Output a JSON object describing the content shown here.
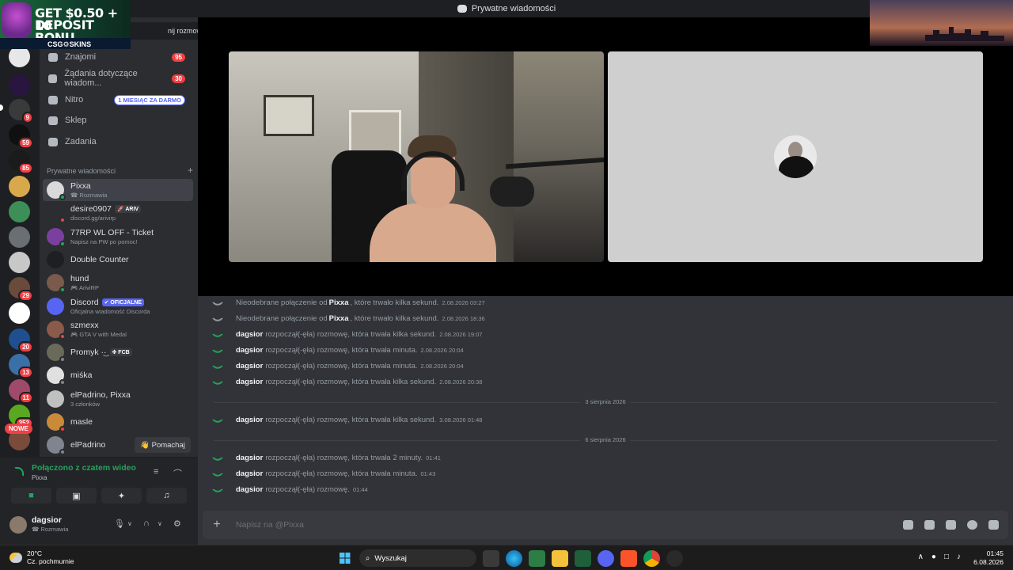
{
  "window": {
    "title": "Prywatne wiadomości"
  },
  "ad": {
    "line1": "GET $0.50 + 10",
    "line2": "DEPOSIT BONU",
    "brand": "CSG⚙SKINS"
  },
  "search": {
    "fragment": "nij rozmowę"
  },
  "rail": {
    "badges": [
      "9",
      "59",
      "85",
      "29",
      "20",
      "13",
      "11",
      "352"
    ],
    "new_label": "NOWE"
  },
  "nav": {
    "friends": {
      "label": "Znajomi",
      "count": "95"
    },
    "requests": {
      "label": "Żądania dotyczące wiadom...",
      "count": "30"
    },
    "nitro": {
      "label": "Nitro",
      "tag": "1 MIESIĄC ZA DARMO"
    },
    "shop": {
      "label": "Sklep"
    },
    "quests": {
      "label": "Zadania"
    }
  },
  "dm_header": {
    "label": "Prywatne wiadomości",
    "add": "+"
  },
  "dms": [
    {
      "name": "Pixxa",
      "sub": "☎ Rozmawia",
      "status": "online",
      "avatar_color": "#d9d9d9"
    },
    {
      "name": "desire0907",
      "tag": "🚀 ARIV",
      "sub": "discord.gg/arivirp",
      "status": "dnd",
      "avatar_color": "#2b2d31"
    },
    {
      "name": "77RP WL OFF - Ticket",
      "sub": "Napisz na PW po pomoc!",
      "status": "online",
      "avatar_color": "#7b3fa0"
    },
    {
      "name": "Double Counter",
      "sub": "",
      "status": "none",
      "avatar_color": "#1e1f22"
    },
    {
      "name": "hund",
      "sub": "🎮 AriviRP",
      "status": "online",
      "avatar_color": "#7a5a4a"
    },
    {
      "name": "Discord",
      "tag": "✔ OFICJALNE",
      "sub": "Oficjalna wiadomość Discorda",
      "status": "none",
      "avatar_color": "#5865f2"
    },
    {
      "name": "szmexx",
      "sub": "🎮 GTA V with Medal",
      "status": "dnd",
      "avatar_color": "#8a5a4a"
    },
    {
      "name": "Promyk ·͜·",
      "tag": "✤ FCB",
      "sub": "",
      "status": "off",
      "avatar_color": "#6a6a5a"
    },
    {
      "name": "miśka",
      "sub": "",
      "status": "off",
      "avatar_color": "#e0e0e0"
    },
    {
      "name": "elPadrino, Pixxa",
      "sub": "3 członków",
      "status": "none",
      "avatar_color": "#c0c0c0"
    },
    {
      "name": "masle",
      "sub": "",
      "status": "dnd",
      "avatar_color": "#c98a3a"
    },
    {
      "name": "elPadrino",
      "sub": "",
      "status": "off",
      "avatar_color": "#80848e"
    }
  ],
  "wave_button": "👋 Pomachaj",
  "voice": {
    "title": "Połączono z czatem wideo",
    "sub": "Pixxa"
  },
  "user": {
    "name": "dagsior",
    "status": "☎ Rozmawia"
  },
  "messages": [
    {
      "type": "missed",
      "prefix": "Nieodebrane połączenie od",
      "who": "Pixxa",
      "text": ", które trwało kilka sekund.",
      "ts": "2.08.2026 03:27"
    },
    {
      "type": "missed",
      "prefix": "Nieodebrane połączenie od",
      "who": "Pixxa",
      "text": ", które trwało kilka sekund.",
      "ts": "2.08.2026 18:36"
    },
    {
      "type": "call",
      "who": "dagsior",
      "text": "rozpoczął(-ęła) rozmowę, która trwała kilka sekund.",
      "ts": "2.08.2026 19:07"
    },
    {
      "type": "call",
      "who": "dagsior",
      "text": "rozpoczął(-ęła) rozmowę, która trwała minuta.",
      "ts": "2.08.2026 20:04"
    },
    {
      "type": "call",
      "who": "dagsior",
      "text": "rozpoczął(-ęła) rozmowę, która trwała minuta.",
      "ts": "2.08.2026 20:04"
    },
    {
      "type": "call",
      "who": "dagsior",
      "text": "rozpoczął(-ęła) rozmowę, która trwała kilka sekund.",
      "ts": "2.08.2026 20:38"
    },
    {
      "type": "divider",
      "label": "3 sierpnia 2026"
    },
    {
      "type": "call",
      "who": "dagsior",
      "text": "rozpoczął(-ęła) rozmowę, która trwała kilka sekund.",
      "ts": "3.08.2026 01:48"
    },
    {
      "type": "divider",
      "label": "6 sierpnia 2026"
    },
    {
      "type": "call",
      "who": "dagsior",
      "text": "rozpoczął(-ęła) rozmowę, która trwała 2 minuty.",
      "ts": "01:41"
    },
    {
      "type": "call",
      "who": "dagsior",
      "text": "rozpoczął(-ęła) rozmowę, która trwała minuta.",
      "ts": "01:43"
    },
    {
      "type": "call",
      "who": "dagsior",
      "text": "rozpoczął(-ęła) rozmowę.",
      "ts": "01:44"
    }
  ],
  "composer": {
    "placeholder": "Napisz na @Pixxa"
  },
  "taskbar": {
    "weather_temp": "20°C",
    "weather_desc": "Cz. pochmurnie",
    "search": "Wyszukaj",
    "time": "01:45",
    "date": "6.08.2026"
  },
  "colors": {
    "accent": "#5865f2",
    "green": "#23a55a",
    "red": "#f23f43",
    "bg": "#313338"
  }
}
